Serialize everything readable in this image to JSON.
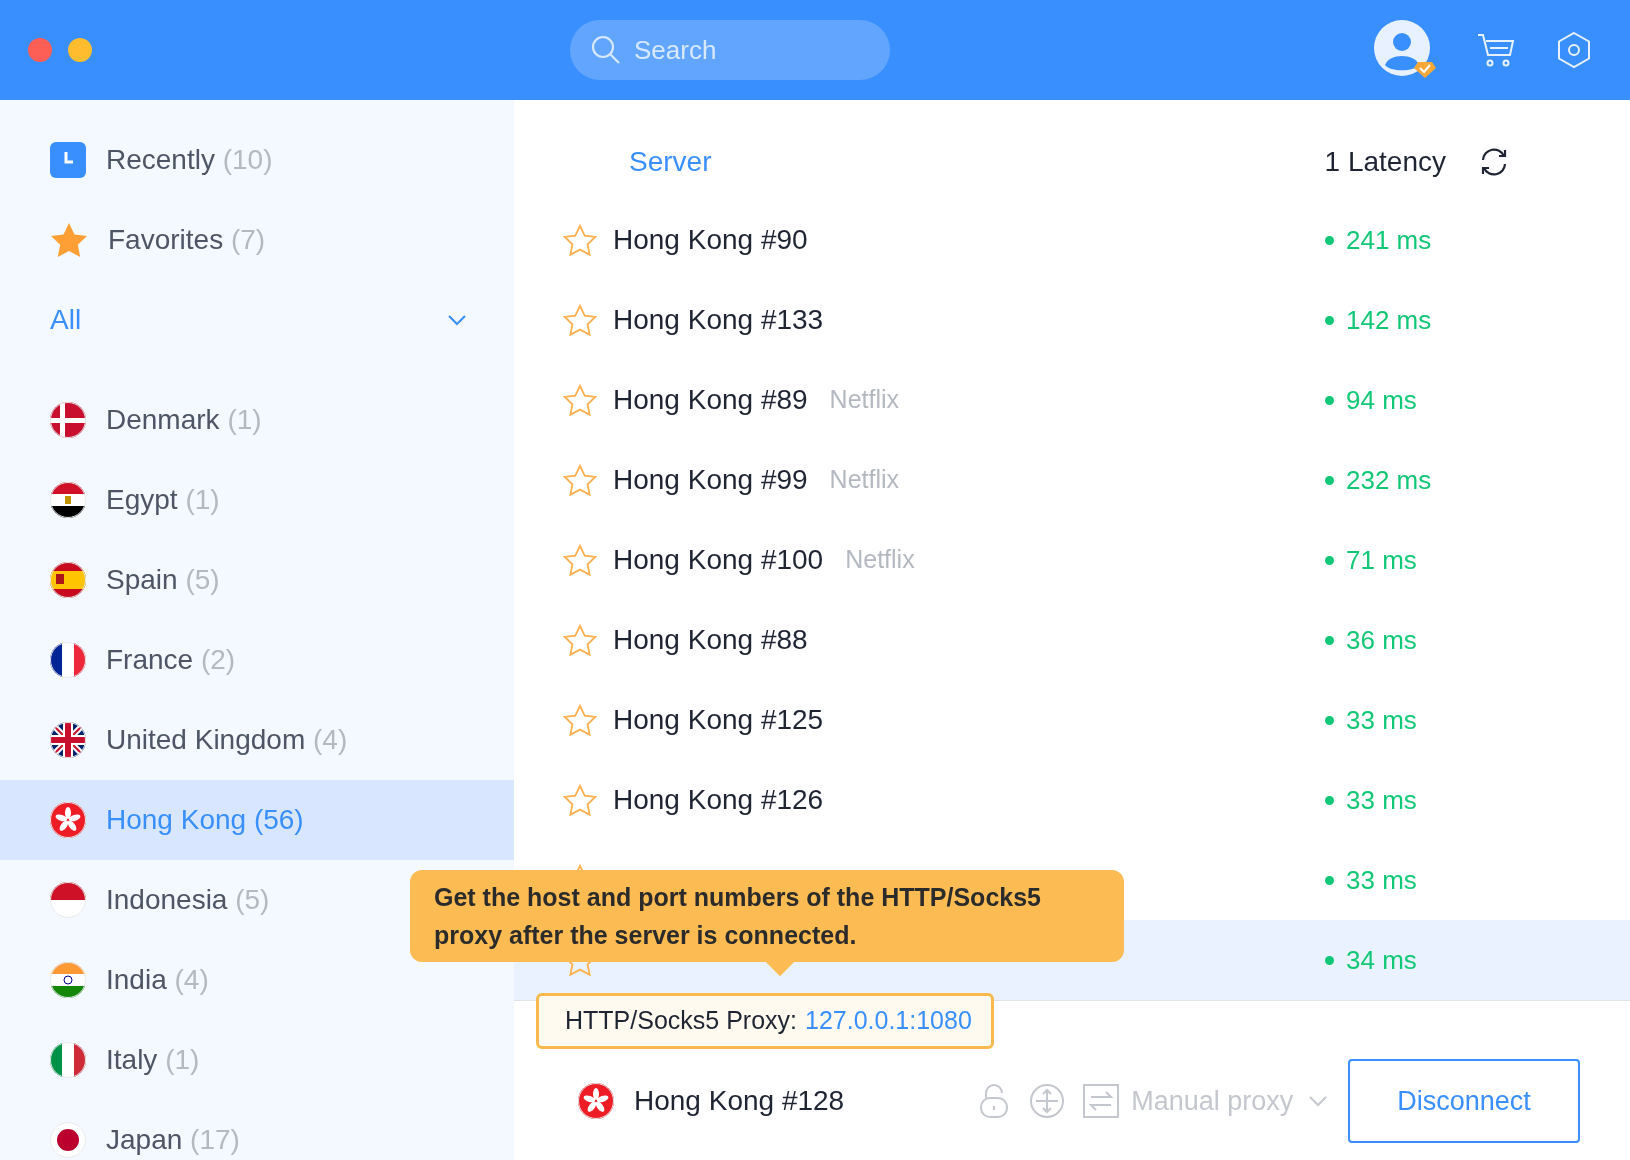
{
  "search": {
    "placeholder": "Search"
  },
  "sidebar": {
    "items": [
      {
        "kind": "recent",
        "label": "Recently",
        "count": "(10)"
      },
      {
        "kind": "favorites",
        "label": "Favorites",
        "count": "(7)"
      }
    ],
    "filter": {
      "label": "All"
    },
    "countries": [
      {
        "label": "Denmark",
        "count": "(1)",
        "selected": false
      },
      {
        "label": "Egypt",
        "count": "(1)",
        "selected": false
      },
      {
        "label": "Spain",
        "count": "(5)",
        "selected": false
      },
      {
        "label": "France",
        "count": "(2)",
        "selected": false
      },
      {
        "label": "United Kingdom",
        "count": "(4)",
        "selected": false
      },
      {
        "label": "Hong Kong",
        "count": "(56)",
        "selected": true
      },
      {
        "label": "Indonesia",
        "count": "(5)",
        "selected": false
      },
      {
        "label": "India",
        "count": "(4)",
        "selected": false
      },
      {
        "label": "Italy",
        "count": "(1)",
        "selected": false
      },
      {
        "label": "Japan",
        "count": "(17)",
        "selected": false
      }
    ]
  },
  "table": {
    "columns": [
      "Server",
      "1 Latency"
    ],
    "rows": [
      {
        "name": "Hong Kong #90",
        "latency": "241 ms",
        "selected": false
      },
      {
        "name": "Hong Kong #133",
        "latency": "142 ms",
        "selected": false
      },
      {
        "name": "Hong Kong #89",
        "tag": "Netflix",
        "latency": "94 ms",
        "selected": false
      },
      {
        "name": "Hong Kong #99",
        "tag": "Netflix",
        "latency": "232 ms",
        "selected": false
      },
      {
        "name": "Hong Kong #100",
        "tag": "Netflix",
        "latency": "71 ms",
        "selected": false
      },
      {
        "name": "Hong Kong #88",
        "latency": "36 ms",
        "selected": false
      },
      {
        "name": "Hong Kong #125",
        "latency": "33 ms",
        "selected": false
      },
      {
        "name": "Hong Kong #126",
        "latency": "33 ms",
        "selected": false
      },
      {
        "latency": "33 ms",
        "selected": false
      },
      {
        "latency": "34 ms",
        "selected": true
      }
    ]
  },
  "tooltip": {
    "text": "Get the host and port numbers of the HTTP/Socks5 proxy after the server is connected."
  },
  "proxy": {
    "label": "HTTP/Socks5 Proxy:",
    "value": "127.0.0.1:1080"
  },
  "connection": {
    "server": "Hong Kong #128",
    "mode": "Manual proxy",
    "button": "Disconnect"
  }
}
